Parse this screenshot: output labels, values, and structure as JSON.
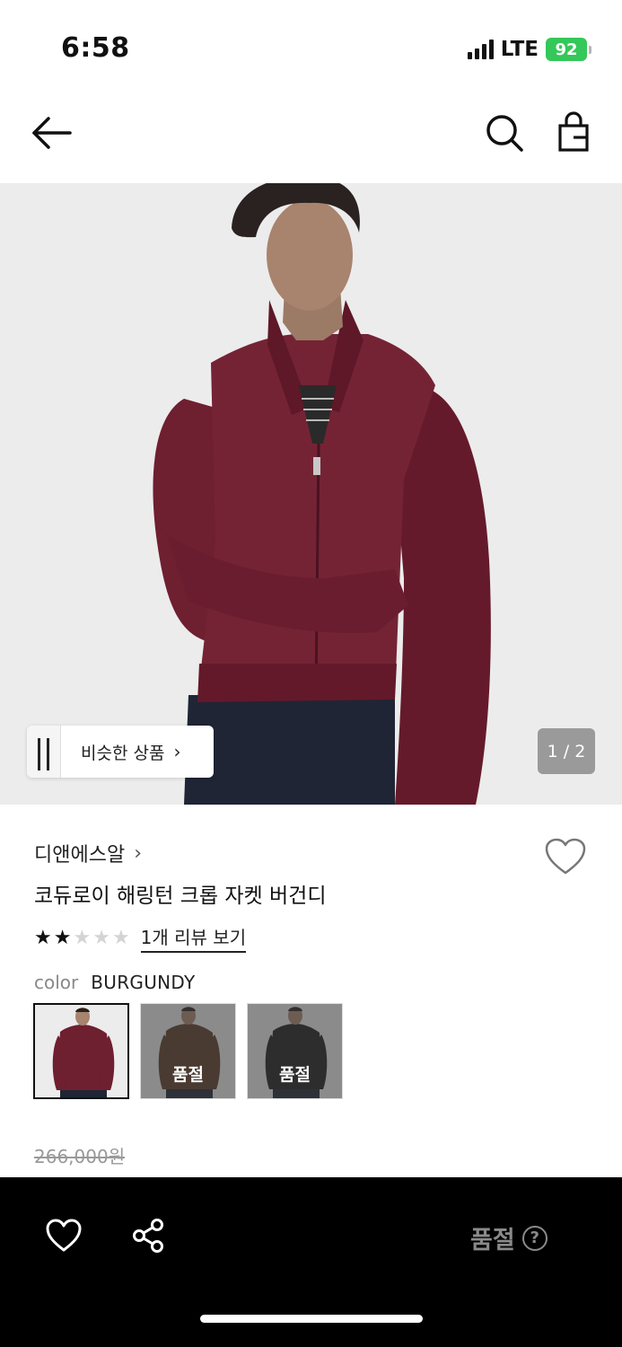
{
  "status_bar": {
    "time": "6:58",
    "network": "LTE",
    "battery": "92"
  },
  "nav": {
    "back_icon": "arrow-left-icon",
    "search_icon": "search-icon",
    "bag_icon": "shopping-bag-icon"
  },
  "gallery": {
    "similar_label": "비슷한 상품",
    "similar_chevron": "›",
    "counter": "1 / 2"
  },
  "product": {
    "brand": "디앤에스알",
    "brand_chevron": "›",
    "title": "코듀로이 해링턴 크롭 자켓 버건디",
    "rating": 2,
    "rating_max": 5,
    "review_link": "1개 리뷰 보기",
    "color_key": "color",
    "color_value": "BURGUNDY",
    "swatches": [
      {
        "color": "#6e1f30",
        "soldout_label": ""
      },
      {
        "color": "#5b3a26",
        "soldout_label": "품절"
      },
      {
        "color": "#1c1c1c",
        "soldout_label": "품절"
      }
    ],
    "original_price": "266,000원"
  },
  "bottom_bar": {
    "soldout_label": "품절",
    "help_icon": "?",
    "heart_icon": "heart-icon",
    "share_icon": "share-icon"
  },
  "colors": {
    "jacket": "#6e1f30",
    "background": "#ececec",
    "battery": "#34c759"
  }
}
